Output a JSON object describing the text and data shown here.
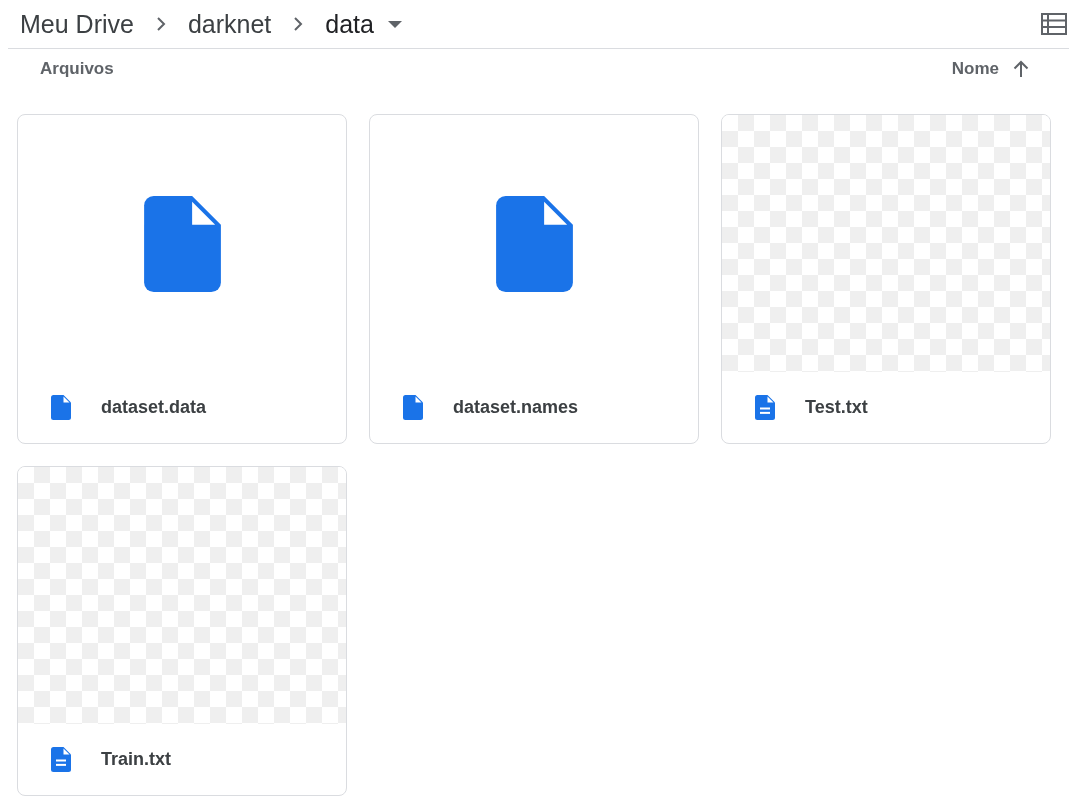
{
  "breadcrumbs": [
    {
      "label": "Meu Drive",
      "current": false
    },
    {
      "label": "darknet",
      "current": false
    },
    {
      "label": "data",
      "current": true
    }
  ],
  "section": {
    "title": "Arquivos",
    "sort_label": "Nome"
  },
  "files": [
    {
      "name": "dataset.data",
      "kind": "file"
    },
    {
      "name": "dataset.names",
      "kind": "file"
    },
    {
      "name": "Test.txt",
      "kind": "doc"
    },
    {
      "name": "Train.txt",
      "kind": "doc"
    }
  ]
}
